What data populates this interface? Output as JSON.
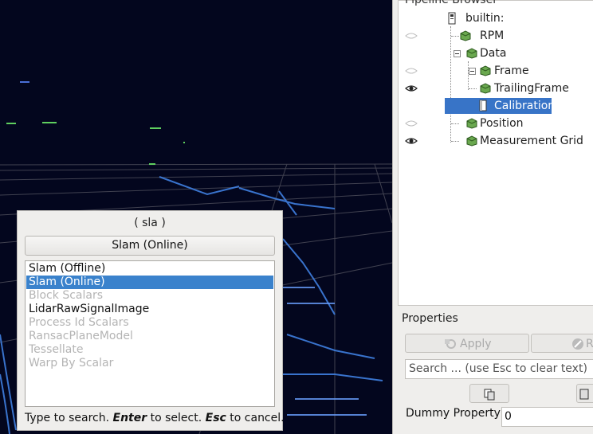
{
  "pipeline_browser": {
    "title": "Pipeline Browser",
    "items": [
      {
        "label": "builtin:",
        "visible": null
      },
      {
        "label": "RPM",
        "visible": false
      },
      {
        "label": "Data",
        "visible": null
      },
      {
        "label": "Frame",
        "visible": false
      },
      {
        "label": "TrailingFrame",
        "visible": true
      },
      {
        "label": "Calibration",
        "visible": null,
        "selected": true
      },
      {
        "label": "Position",
        "visible": false
      },
      {
        "label": "Measurement Grid",
        "visible": true
      }
    ]
  },
  "properties": {
    "title": "Properties",
    "apply_label": "Apply",
    "reset_label": "Re",
    "search_placeholder": "Search ... (use Esc to clear text)",
    "dummy_label": "Dummy Property",
    "dummy_value": "0"
  },
  "quick_launch": {
    "query": "( sla )",
    "selected_button": "Slam (Online)",
    "items": [
      {
        "label": "Slam (Offline)",
        "enabled": true,
        "selected": false
      },
      {
        "label": "Slam (Online)",
        "enabled": true,
        "selected": true
      },
      {
        "label": "Block Scalars",
        "enabled": false,
        "selected": false
      },
      {
        "label": "LidarRawSignalImage",
        "enabled": true,
        "selected": false
      },
      {
        "label": "Process Id Scalars",
        "enabled": false,
        "selected": false
      },
      {
        "label": "RansacPlaneModel",
        "enabled": false,
        "selected": false
      },
      {
        "label": "Tessellate",
        "enabled": false,
        "selected": false
      },
      {
        "label": "Warp By Scalar",
        "enabled": false,
        "selected": false
      }
    ],
    "help": {
      "part1": "Type to search.",
      "enter": "Enter",
      "part2": "to select.",
      "esc": "Esc",
      "part3": "to cancel."
    }
  },
  "colors": {
    "viewport_bg": "#03061e",
    "selection": "#3a82cc",
    "pipeline_green": "#6aa84f"
  }
}
